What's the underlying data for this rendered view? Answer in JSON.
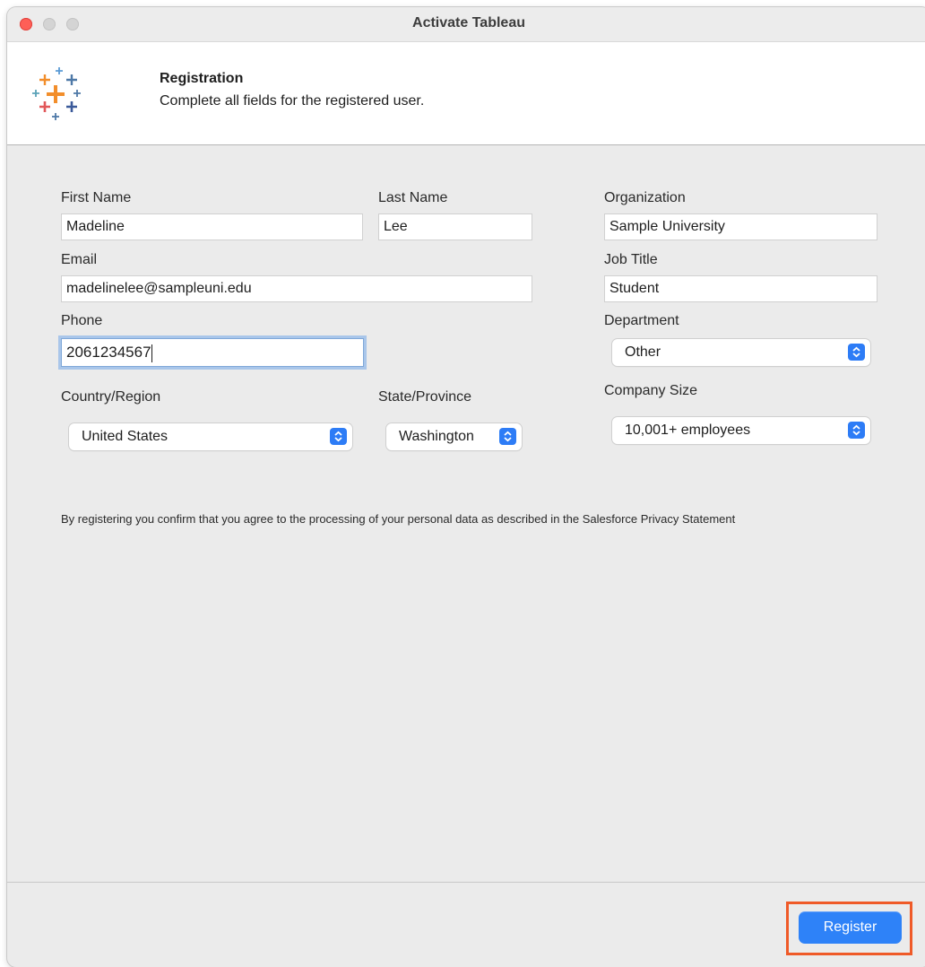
{
  "window": {
    "title": "Activate Tableau"
  },
  "header": {
    "title": "Registration",
    "subtitle": "Complete all fields for the registered user."
  },
  "form": {
    "first_name": {
      "label": "First Name",
      "value": "Madeline"
    },
    "last_name": {
      "label": "Last Name",
      "value": "Lee"
    },
    "organization": {
      "label": "Organization",
      "value": "Sample University"
    },
    "email": {
      "label": "Email",
      "value": "madelinelee@sampleuni.edu"
    },
    "job_title": {
      "label": "Job Title",
      "value": "Student"
    },
    "phone": {
      "label": "Phone",
      "value": "2061234567"
    },
    "department": {
      "label": "Department",
      "value": "Other"
    },
    "country": {
      "label": "Country/Region",
      "value": "United States"
    },
    "state": {
      "label": "State/Province",
      "value": "Washington"
    },
    "company_size": {
      "label": "Company Size",
      "value": "10,001+ employees"
    }
  },
  "consent_text": "By registering you confirm that you agree to the processing of your personal data as described in the Salesforce Privacy Statement",
  "footer": {
    "register_label": "Register"
  },
  "colors": {
    "accent": "#2e82f8",
    "highlight": "#ef5a28",
    "close": "#fe5f57"
  }
}
